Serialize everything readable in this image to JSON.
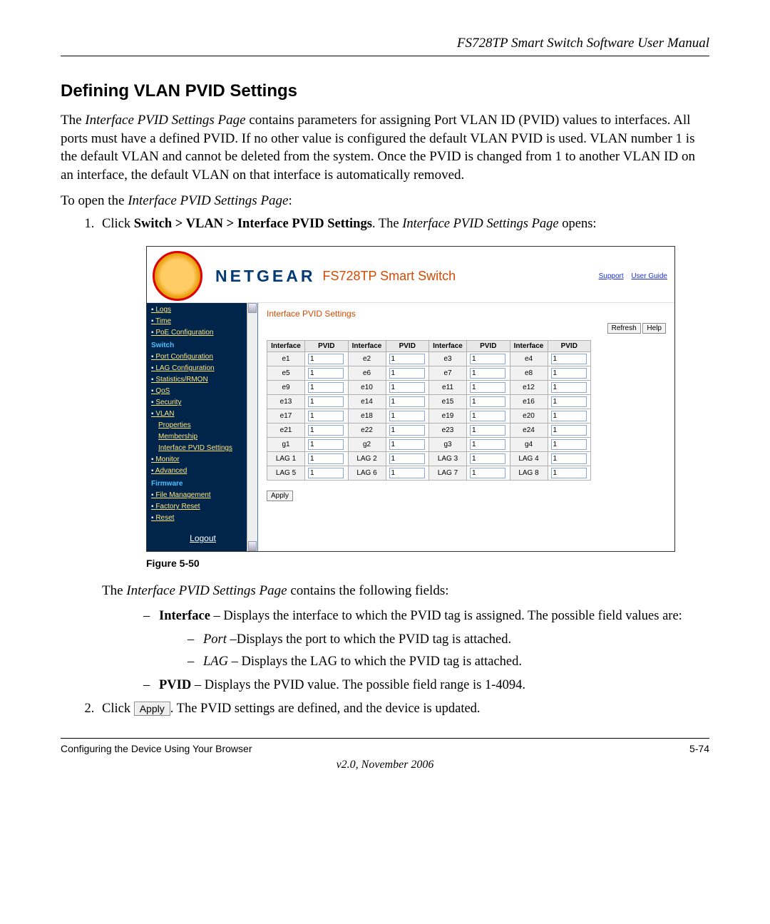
{
  "doc_header": "FS728TP Smart Switch Software User Manual",
  "h2": "Defining VLAN PVID Settings",
  "para1_a": "The ",
  "para1_b": "Interface PVID Settings Page",
  "para1_c": " contains parameters for assigning Port VLAN ID (PVID) values to interfaces. All ports must have a defined PVID. If no other value is configured the default VLAN PVID is used. VLAN number 1 is the default VLAN and cannot be deleted from the system. Once the PVID is changed from 1 to another VLAN ID on an interface, the default VLAN on that interface is automatically removed.",
  "open_a": "To open the ",
  "open_b": "Interface PVID Settings Page",
  "open_c": ":",
  "step1_a": "Click ",
  "step1_b": "Switch > VLAN > Interface PVID Settings",
  "step1_c": ". The ",
  "step1_d": "Interface PVID Settings Page",
  "step1_e": " opens:",
  "ss": {
    "brand": "NETGEAR",
    "model": "FS728TP Smart Switch",
    "support": "Support",
    "user_guide": "User Guide",
    "side": [
      "Logs",
      "Time",
      "PoE Configuration",
      "Switch",
      "Port Configuration",
      "LAG Configuration",
      "Statistics/RMON",
      "QoS",
      "Security",
      "VLAN",
      "Properties",
      "Membership",
      "Interface PVID Settings",
      "Monitor",
      "Advanced",
      "Firmware",
      "File Management",
      "Factory Reset",
      "Reset",
      "Logout"
    ],
    "title": "Interface PVID Settings",
    "refresh": "Refresh",
    "help": "Help",
    "col_interface": "Interface",
    "col_pvid": "PVID",
    "rows": [
      [
        "e1",
        "1",
        "e2",
        "1",
        "e3",
        "1",
        "e4",
        "1"
      ],
      [
        "e5",
        "1",
        "e6",
        "1",
        "e7",
        "1",
        "e8",
        "1"
      ],
      [
        "e9",
        "1",
        "e10",
        "1",
        "e11",
        "1",
        "e12",
        "1"
      ],
      [
        "e13",
        "1",
        "e14",
        "1",
        "e15",
        "1",
        "e16",
        "1"
      ],
      [
        "e17",
        "1",
        "e18",
        "1",
        "e19",
        "1",
        "e20",
        "1"
      ],
      [
        "e21",
        "1",
        "e22",
        "1",
        "e23",
        "1",
        "e24",
        "1"
      ],
      [
        "g1",
        "1",
        "g2",
        "1",
        "g3",
        "1",
        "g4",
        "1"
      ],
      [
        "LAG 1",
        "1",
        "LAG 2",
        "1",
        "LAG 3",
        "1",
        "LAG 4",
        "1"
      ],
      [
        "LAG 5",
        "1",
        "LAG 6",
        "1",
        "LAG 7",
        "1",
        "LAG 8",
        "1"
      ]
    ],
    "apply": "Apply"
  },
  "fig": "Figure 5-50",
  "fields_intro_a": "The ",
  "fields_intro_b": "Interface PVID Settings Page",
  "fields_intro_c": " contains the following fields:",
  "f1_a": "Interface",
  "f1_b": " – Displays the interface to which the PVID tag is assigned. The possible field values are:",
  "f1s1_a": "Port",
  "f1s1_b": " –Displays the port to which the PVID tag is attached.",
  "f1s2_a": "LAG",
  "f1s2_b": " – Displays the LAG to which the PVID tag is attached.",
  "f2_a": "PVID",
  "f2_b": " – Displays the PVID value. The possible field range is 1-4094.",
  "step2_a": "Click ",
  "step2_btn": "Apply",
  "step2_b": ". The PVID settings are defined, and the device is updated.",
  "footer_left": "Configuring the Device Using Your Browser",
  "footer_right": "5-74",
  "footer_v": "v2.0, November 2006"
}
